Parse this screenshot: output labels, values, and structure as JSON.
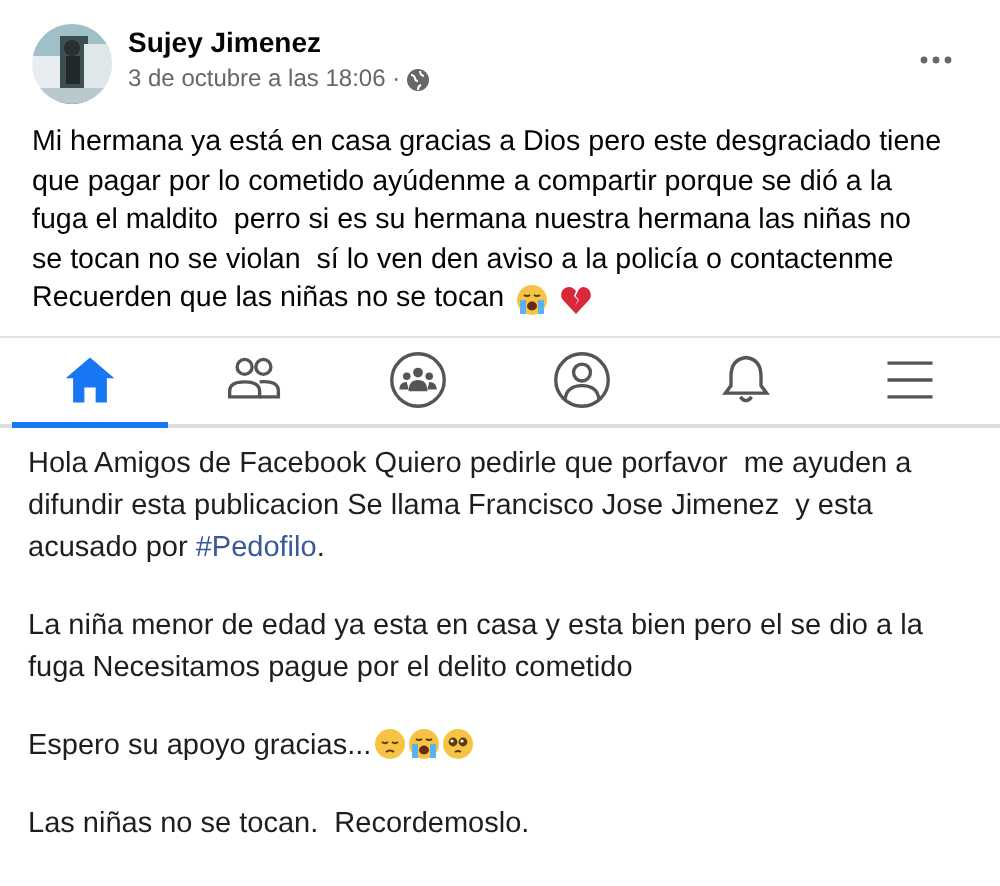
{
  "post": {
    "author": "Sujey Jimenez",
    "date": "3 de octubre a las 18:06 ·",
    "lines": [
      "Mi hermana ya está en casa gracias a Dios pero este desgraciado tiene",
      "que pagar por lo cometido ayúdenme a compartir porque se dió a la",
      "fuga el maldito  perro si es su hermana nuestra hermana las niñas no",
      "se tocan no se violan  sí lo ven den aviso a la policía o contactenme",
      "Recuerden que las niñas no se tocan"
    ],
    "emoji": [
      {
        "kind": "crying"
      },
      {
        "kind": "broken_heart"
      }
    ]
  },
  "shared_screen": {
    "tabs": [
      {
        "kind": "home",
        "selected": true
      },
      {
        "kind": "friends",
        "selected": false
      },
      {
        "kind": "groups",
        "selected": false
      },
      {
        "kind": "profile",
        "selected": false
      },
      {
        "kind": "bell",
        "selected": false
      },
      {
        "kind": "menu",
        "selected": false
      }
    ],
    "paragraphs": [
      {
        "text": "Hola Amigos de Facebook Quiero pedirle que porfavor  me ayuden a difundir esta publicacion Se llama Francisco Jose Jimenez  y esta acusado por ",
        "link": "#Pedofilo",
        "after": "."
      },
      {
        "text": "La niña menor de edad ya esta en casa y esta bien pero el se dio a la fuga Necesitamos pague por el delito cometido"
      },
      {
        "text": "Espero su apoyo gracias...",
        "emoji": [
          {
            "kind": "sad"
          },
          {
            "kind": "crying"
          },
          {
            "kind": "pleading"
          }
        ]
      },
      {
        "text": "Las niñas no se tocan.  Recordemoslo."
      }
    ]
  }
}
